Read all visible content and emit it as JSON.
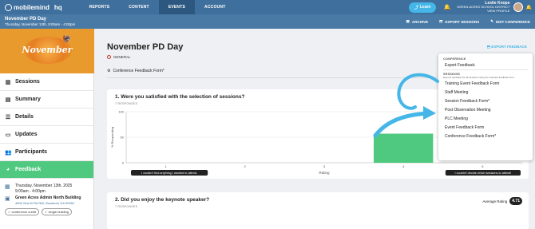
{
  "nav": {
    "brand": "mobilemind",
    "hq": "hq",
    "items": [
      {
        "label": "REPORTS"
      },
      {
        "label": "CONTENT"
      },
      {
        "label": "EVENTS"
      },
      {
        "label": "ACCOUNT"
      }
    ],
    "learn_label": "Learn",
    "user_name": "Leslie Knope",
    "district": "GREEN ACRES SCHOOL DISTRICT",
    "view_profile": "VIEW PROFILE"
  },
  "subheader": {
    "title": "November PD Day",
    "date": "Thursday, November 13th, 9:00am - 4:00pm",
    "actions": [
      {
        "label": "ARCHIVE"
      },
      {
        "label": "EXPORT SESSIONS"
      },
      {
        "label": "EDIT CONFERENCE"
      }
    ]
  },
  "sidebar": {
    "banner_text": "November",
    "items": [
      {
        "label": "Sessions",
        "icon": "sessions-icon"
      },
      {
        "label": "Summary",
        "icon": "summary-icon"
      },
      {
        "label": "Details",
        "icon": "details-icon"
      },
      {
        "label": "Updates",
        "icon": "updates-icon"
      },
      {
        "label": "Participants",
        "icon": "participants-icon"
      },
      {
        "label": "Feedback",
        "icon": "feedback-icon"
      }
    ],
    "date_line1": "Thursday, November 13th, 2025",
    "date_line2": "9:00am - 4:00pm",
    "location_name": "Green Acres Admin North Building",
    "location_address": "4500 Sea W Rd NW, Rossboro GA 30352",
    "tags": [
      "conference credit",
      "single building"
    ]
  },
  "main": {
    "title": "November PD Day",
    "export_feedback": "EXPORT FEEDBACK",
    "category": "GENERAL",
    "form_name": "Conference Feedback Form*",
    "q1": {
      "title": "1. Were you satisfied with the selection of sessions?",
      "responses": "7 RESPONSES"
    },
    "q2": {
      "title": "2. Did you enjoy the keynote speaker?",
      "responses": "7 RESPONSES",
      "avg_label": "Average Rating",
      "avg_value": "4.71"
    }
  },
  "chart_data": {
    "type": "bar",
    "categories": [
      "1",
      "2",
      "3",
      "4",
      "5"
    ],
    "values": [
      0,
      0,
      0,
      57,
      0
    ],
    "ylabel": "% Responding",
    "xlabel": "Rating",
    "ylim": [
      0,
      100
    ],
    "yticks": [
      0,
      50,
      100
    ],
    "bar_color": "#4ec97f",
    "low_label": "I couldn't find anything I wanted to attend.",
    "high_label": "I couldn't decide which sessions to attend!"
  },
  "dropdown": {
    "sec_conference": "CONFERENCE",
    "export_feedback": "Export Feedback",
    "sec_sessions": "SESSIONS",
    "sessions_desc": "Exports feedback for all sessions using the selected feedback form.",
    "items": [
      {
        "label": "Training Event Feedback Form"
      },
      {
        "label": "Staff Meeting"
      },
      {
        "label": "Session Feedback Form*"
      },
      {
        "label": "Post Observation Meeting"
      },
      {
        "label": "PLC Meeting"
      },
      {
        "label": "Event Feedback Form"
      },
      {
        "label": "Conference Feedback Form*"
      }
    ]
  },
  "colors": {
    "nav": "#3f6f9c",
    "accent_green": "#4ec97f",
    "accent_blue": "#45b6e8"
  }
}
